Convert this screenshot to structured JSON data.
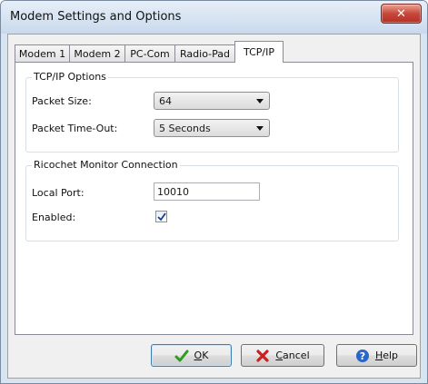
{
  "window": {
    "title": "Modem Settings and Options",
    "close_symbol": "✕"
  },
  "tabs": [
    {
      "label": "Modem 1"
    },
    {
      "label": "Modem 2"
    },
    {
      "label": "PC-Com"
    },
    {
      "label": "Radio-Pad"
    },
    {
      "label": "TCP/IP"
    }
  ],
  "active_tab": "TCP/IP",
  "tcpip_options": {
    "legend": "TCP/IP Options",
    "packet_size_label": "Packet Size:",
    "packet_size_value": "64",
    "packet_timeout_label": "Packet Time-Out:",
    "packet_timeout_value": "5 Seconds"
  },
  "ricochet": {
    "legend": "Ricochet Monitor Connection",
    "local_port_label": "Local Port:",
    "local_port_value": "10010",
    "enabled_label": "Enabled:",
    "enabled_checked": true
  },
  "buttons": {
    "ok_hotkey": "O",
    "ok_rest": "K",
    "cancel_hotkey": "C",
    "cancel_rest": "ancel",
    "help_hotkey": "H",
    "help_rest": "elp"
  },
  "colors": {
    "check_green": "#2e9a1f",
    "cancel_red": "#cc2020",
    "help_blue": "#2a66c8"
  }
}
